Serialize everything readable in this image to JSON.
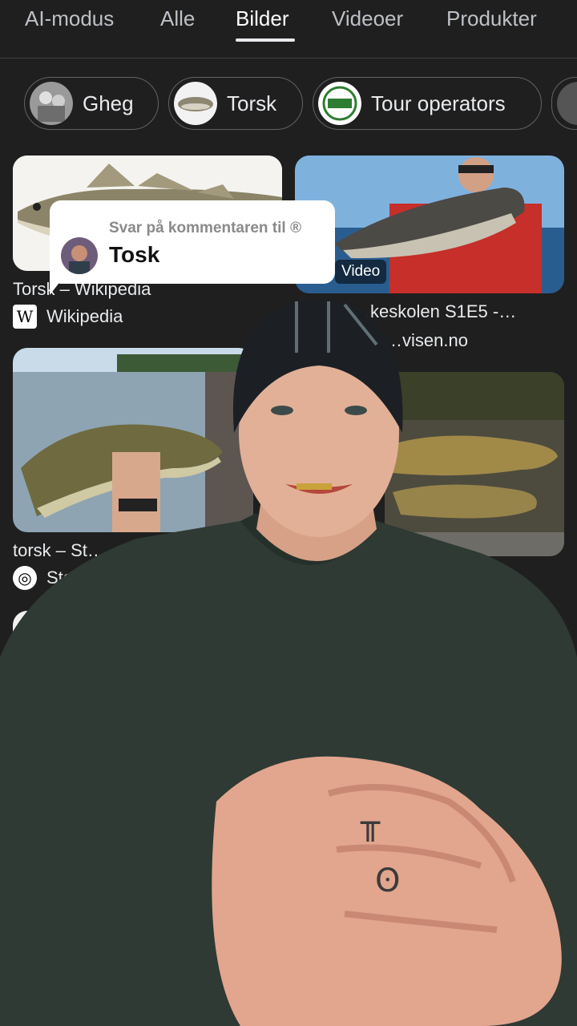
{
  "tabs": [
    {
      "label": "AI-modus"
    },
    {
      "label": "Alle"
    },
    {
      "label": "Bilder"
    },
    {
      "label": "Videoer"
    },
    {
      "label": "Produkter"
    }
  ],
  "active_tab": "Bilder",
  "chips": [
    {
      "label": "Gheg"
    },
    {
      "label": "Torsk"
    },
    {
      "label": "Tour operators"
    }
  ],
  "results": [
    {
      "title": "Torsk – Wikipedia",
      "source": "Wikipedia"
    },
    {
      "title": "…keskolen S1E5 -…",
      "source": "…visen.no",
      "badge": "Video"
    },
    {
      "title": "torsk – St…",
      "source": "Sto…"
    }
  ],
  "comment_bubble": {
    "subtitle": "Svar på kommentaren til ®",
    "text": "Tosk"
  },
  "colors": {
    "background": "#1f1f1f",
    "accent": "#e8eaed",
    "sweater": "#2e3a33",
    "beanie": "#1c2024"
  }
}
